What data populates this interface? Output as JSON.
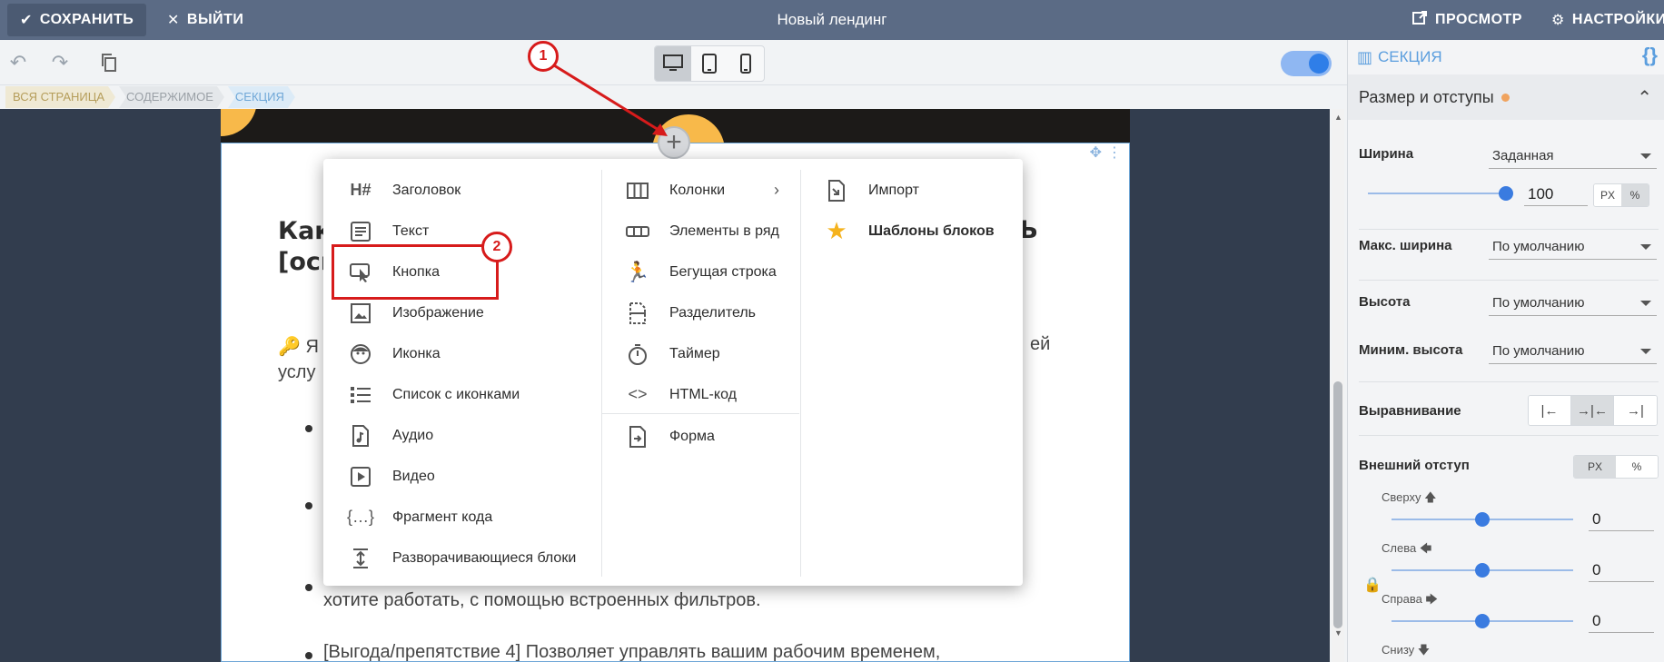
{
  "topbar": {
    "save_label": "СОХРАНИТЬ",
    "exit_label": "ВЫЙТИ",
    "title": "Новый лендинг",
    "preview_label": "ПРОСМОТР",
    "settings_label": "НАСТРОЙКИ"
  },
  "breadcrumb": [
    "ВСЯ СТРАНИЦА",
    "СОДЕРЖИМОЕ",
    "СЕКЦИЯ"
  ],
  "page": {
    "heading_line1": "Как",
    "heading_line2": "[осн",
    "heading_right": "ть",
    "para_line1": "🔑 Я",
    "para_line2": "услу",
    "para_right": "ей",
    "bullet3_line2": "хотите работать, с помощью встроенных фильтров.",
    "bullet4": "[Выгода/препятствие 4] Позволяет управлять вашим рабочим временем,"
  },
  "menu": {
    "col1": [
      "Заголовок",
      "Текст",
      "Кнопка",
      "Изображение",
      "Иконка",
      "Список с иконками",
      "Аудио",
      "Видео",
      "Фрагмент кода",
      "Разворачивающиеся блоки"
    ],
    "col2": [
      "Колонки",
      "Элементы в ряд",
      "Бегущая строка",
      "Разделитель",
      "Таймер",
      "HTML-код",
      "Форма"
    ],
    "col3": [
      "Импорт",
      "Шаблоны блоков"
    ]
  },
  "annotations": {
    "badge1": "1",
    "badge2": "2"
  },
  "panel": {
    "header": "СЕКЦИЯ",
    "section_title": "Размер и отступы",
    "width_label": "Ширина",
    "width_value": "Заданная",
    "width_number": "100",
    "unit_px": "PX",
    "unit_pct": "%",
    "max_width_label": "Макс. ширина",
    "max_width_value": "По умолчанию",
    "height_label": "Высота",
    "height_value": "По умолчанию",
    "min_height_label": "Миним. высота",
    "min_height_value": "По умолчанию",
    "align_label": "Выравнивание",
    "margin_label": "Внешний отступ",
    "top_label": "Сверху",
    "left_label": "Слева",
    "right_label": "Справа",
    "bottom_label": "Снизу",
    "top_value": "0",
    "left_value": "0",
    "right_value": "0",
    "width_slider_fraction": 1.0,
    "margin_slider_fraction": 0.5
  },
  "colors": {
    "topbar": "#5b6b85",
    "accent": "#3a7be0",
    "annotation": "#d71b1b"
  }
}
